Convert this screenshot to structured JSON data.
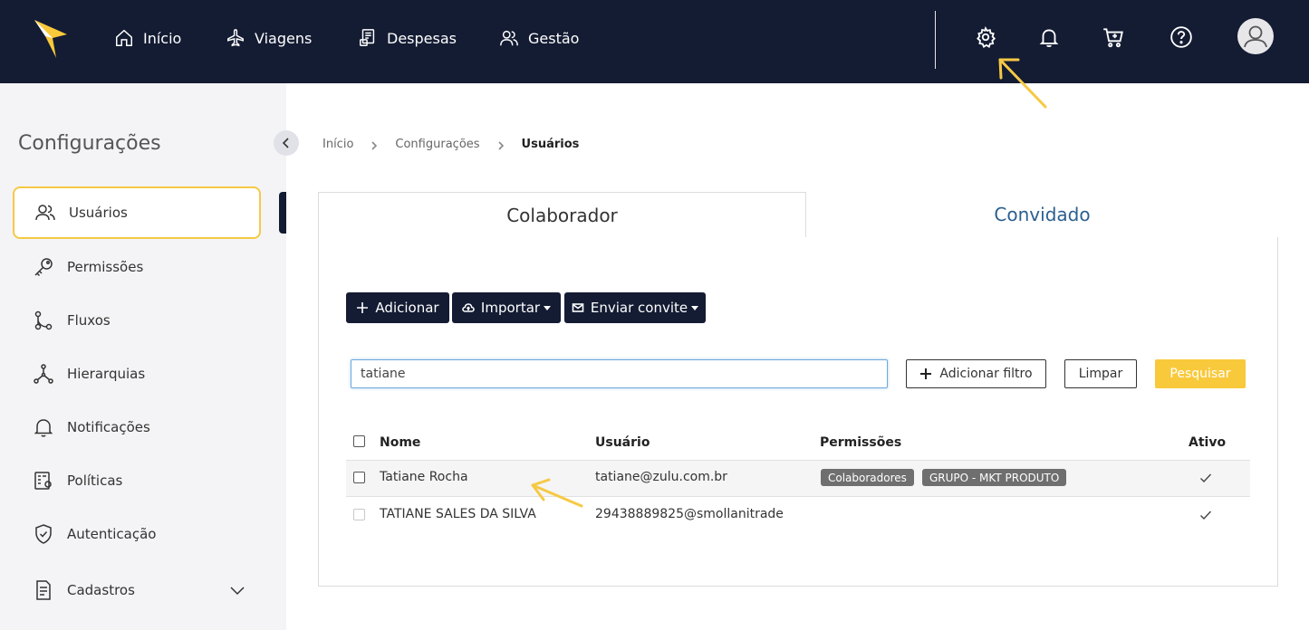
{
  "nav": {
    "items": [
      {
        "label": "Início",
        "icon": "home-icon"
      },
      {
        "label": "Viagens",
        "icon": "plane-icon"
      },
      {
        "label": "Despesas",
        "icon": "receipt-icon"
      },
      {
        "label": "Gestão",
        "icon": "users-icon"
      }
    ],
    "right_icons": [
      "gear-icon",
      "bell-icon",
      "cart-icon",
      "help-icon",
      "avatar"
    ]
  },
  "sidebar": {
    "title": "Configurações",
    "items": [
      {
        "label": "Usuários",
        "icon": "users-icon",
        "active": true
      },
      {
        "label": "Permissões",
        "icon": "key-icon"
      },
      {
        "label": "Fluxos",
        "icon": "flow-icon"
      },
      {
        "label": "Hierarquias",
        "icon": "hierarchy-icon"
      },
      {
        "label": "Notificações",
        "icon": "bell-icon"
      },
      {
        "label": "Políticas",
        "icon": "policy-icon"
      },
      {
        "label": "Autenticação",
        "icon": "shield-icon"
      },
      {
        "label": "Cadastros",
        "icon": "document-icon",
        "expandable": true
      }
    ]
  },
  "breadcrumb": [
    "Início",
    "Configurações",
    "Usuários"
  ],
  "tabs": {
    "colaborador": "Colaborador",
    "convidado": "Convidado"
  },
  "actions": {
    "add": "Adicionar",
    "import": "Importar",
    "invite": "Enviar convite"
  },
  "search": {
    "value": "tatiane",
    "add_filter": "Adicionar filtro",
    "clear": "Limpar",
    "submit": "Pesquisar"
  },
  "table": {
    "columns": [
      "Nome",
      "Usuário",
      "Permissões",
      "Ativo"
    ],
    "rows": [
      {
        "nome": "Tatiane Rocha",
        "usuario": "tatiane@zulu.com.br",
        "permissoes": [
          "Colaboradores",
          "GRUPO - MKT PRODUTO"
        ],
        "ativo": true
      },
      {
        "nome": "TATIANE SALES DA SILVA",
        "usuario": "29438889825@smollanitrade",
        "permissoes": [],
        "ativo": true
      }
    ]
  },
  "colors": {
    "navbar": "#141c33",
    "accent_yellow": "#f9c93c",
    "link_blue": "#2b5f8f",
    "badge_gray": "#6f6f6f"
  }
}
